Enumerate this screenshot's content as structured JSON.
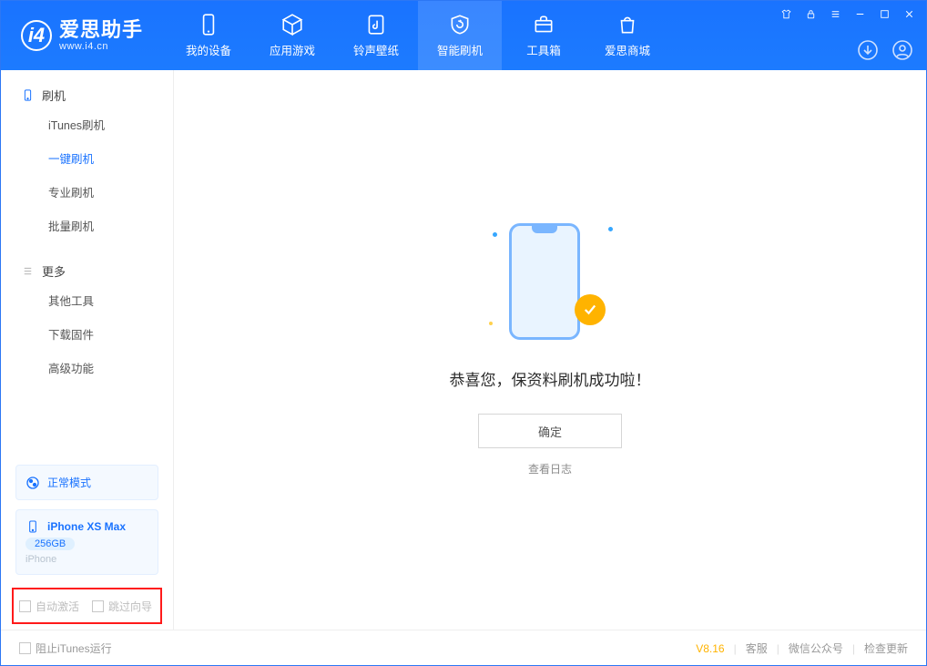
{
  "app": {
    "name": "爱思助手",
    "url": "www.i4.cn"
  },
  "nav": {
    "device": "我的设备",
    "apps": "应用游戏",
    "ring": "铃声壁纸",
    "flash": "智能刷机",
    "toolbox": "工具箱",
    "store": "爱思商城"
  },
  "sidebar": {
    "section1": "刷机",
    "items1": {
      "itunes": "iTunes刷机",
      "oneclick": "一键刷机",
      "pro": "专业刷机",
      "batch": "批量刷机"
    },
    "section2": "更多",
    "items2": {
      "other": "其他工具",
      "firmware": "下载固件",
      "adv": "高级功能"
    },
    "mode": "正常模式",
    "device_name": "iPhone XS Max",
    "device_cap": "256GB",
    "device_type": "iPhone",
    "opt_auto": "自动激活",
    "opt_skip": "跳过向导"
  },
  "main": {
    "success_text": "恭喜您，保资料刷机成功啦！",
    "ok": "确定",
    "view_log": "查看日志"
  },
  "statusbar": {
    "block_itunes": "阻止iTunes运行",
    "version": "V8.16",
    "cs": "客服",
    "wechat": "微信公众号",
    "update": "检查更新"
  }
}
